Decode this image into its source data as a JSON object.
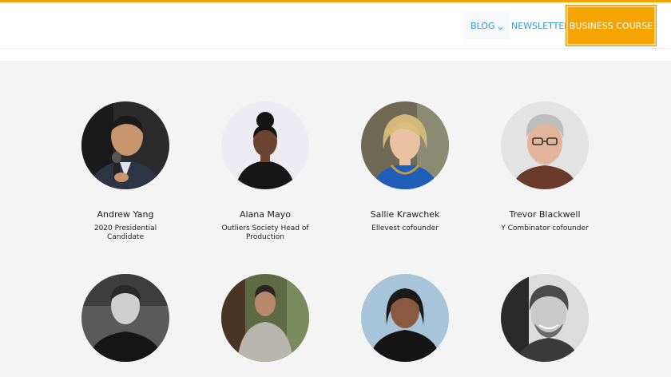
{
  "nav": {
    "blog_label": "BLOG",
    "newsletter_label": "NEWSLETTER",
    "course_label": "BUSINESS COURSE",
    "accent_color": "#f5a300",
    "link_color": "#2a9fd6"
  },
  "people": [
    {
      "name": "Andrew Yang",
      "role": "2020 Presidential Candidate"
    },
    {
      "name": "Alana Mayo",
      "role": "Outliers Society Head of Production"
    },
    {
      "name": "Sallie Krawchek",
      "role": "Ellevest cofounder"
    },
    {
      "name": "Trevor Blackwell",
      "role": "Y Combinator cofounder"
    },
    {
      "name": "",
      "role": ""
    },
    {
      "name": "",
      "role": ""
    },
    {
      "name": "",
      "role": ""
    },
    {
      "name": "",
      "role": ""
    }
  ]
}
